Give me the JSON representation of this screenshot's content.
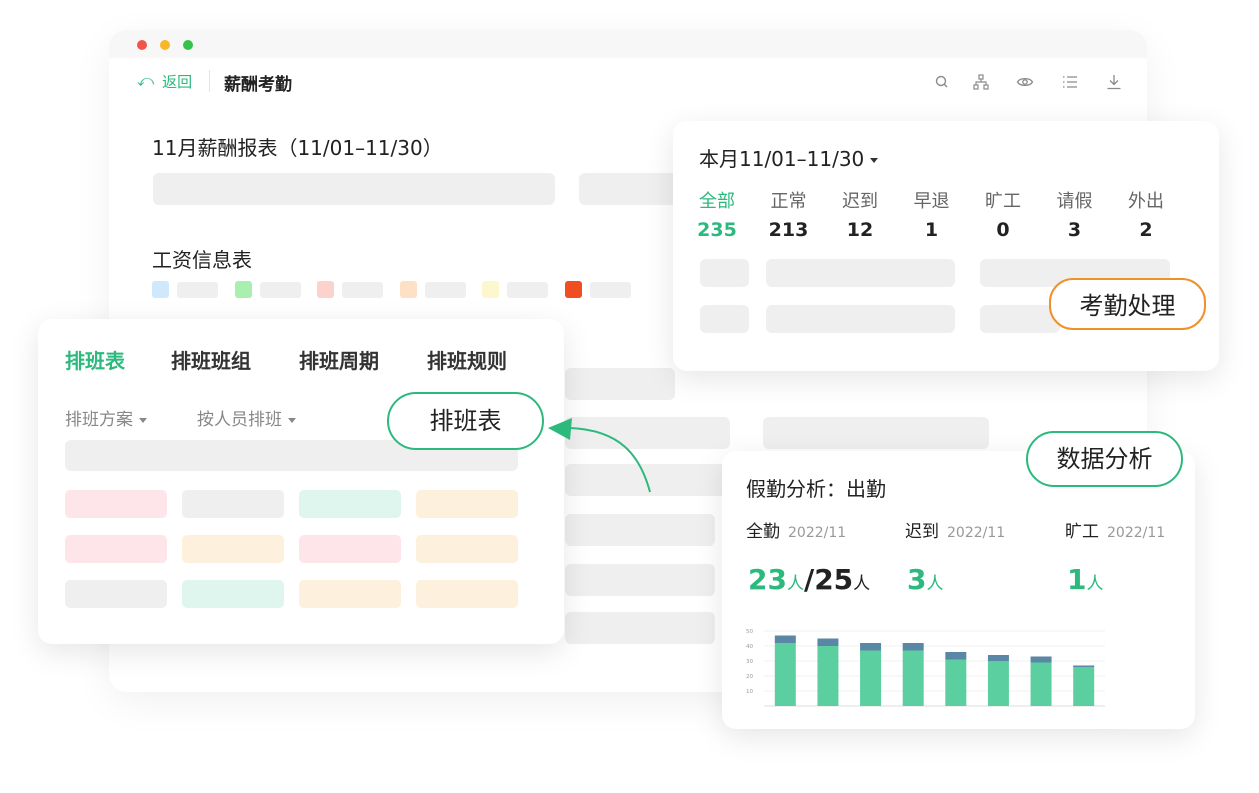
{
  "window": {
    "back_label": "返回",
    "title": "薪酬考勤",
    "report_title": "11月薪酬报表（11/01–11/30）",
    "salary_table_title": "工资信息表",
    "legend_colors": [
      "#cfe8fb",
      "#a8efb0",
      "#fbd2cc",
      "#fde0c5",
      "#fdf7cf",
      "#ef4d22"
    ],
    "header_icons": [
      "search-icon",
      "org-chart-icon",
      "eye-icon",
      "list-icon",
      "download-icon"
    ]
  },
  "schedule": {
    "tabs": [
      "排班表",
      "排班班组",
      "排班周期",
      "排班规则"
    ],
    "active_tab": 0,
    "dropdown1": "排班方案",
    "dropdown2": "按人员排班",
    "callout": "排班表",
    "cell_colors": [
      [
        "#fde5ea",
        "#efefef",
        "#def6ee",
        "#fdf0dc"
      ],
      [
        "#fde5ea",
        "#fdf0dc",
        "#fde5ea",
        "#fdf0dc"
      ],
      [
        "#efefef",
        "#def6ee",
        "#fdf0dc",
        "#fdf0dc"
      ]
    ]
  },
  "attendance": {
    "period": "本月11/01–11/30",
    "callout": "考勤处理",
    "stats": [
      {
        "label": "全部",
        "value": "235",
        "active": true
      },
      {
        "label": "正常",
        "value": "213"
      },
      {
        "label": "迟到",
        "value": "12"
      },
      {
        "label": "早退",
        "value": "1"
      },
      {
        "label": "旷工",
        "value": "0"
      },
      {
        "label": "请假",
        "value": "3"
      },
      {
        "label": "外出",
        "value": "2"
      }
    ]
  },
  "analysis": {
    "title": "假勤分析：出勤",
    "callout": "数据分析",
    "metrics": [
      {
        "label": "全勤",
        "date": "2022/11",
        "value": "23",
        "unit": "人",
        "sep": "/",
        "total": "25",
        "total_unit": "人"
      },
      {
        "label": "迟到",
        "date": "2022/11",
        "value": "3",
        "unit": "人"
      },
      {
        "label": "旷工",
        "date": "2022/11",
        "value": "1",
        "unit": "人"
      }
    ]
  },
  "chart_data": {
    "type": "bar",
    "stacked": true,
    "categories": [
      "",
      "",
      "",
      "",
      "",
      "",
      "",
      ""
    ],
    "yticks": [
      "50",
      "40",
      "30",
      "20",
      "10"
    ],
    "ylim": [
      0,
      50
    ],
    "colors": [
      "#5ccfa0",
      "#5b87a6"
    ],
    "series": [
      {
        "values": [
          42,
          40,
          37,
          37,
          31,
          30,
          29,
          26
        ]
      },
      {
        "values": [
          5,
          5,
          5,
          5,
          5,
          4,
          4,
          1
        ]
      }
    ]
  }
}
